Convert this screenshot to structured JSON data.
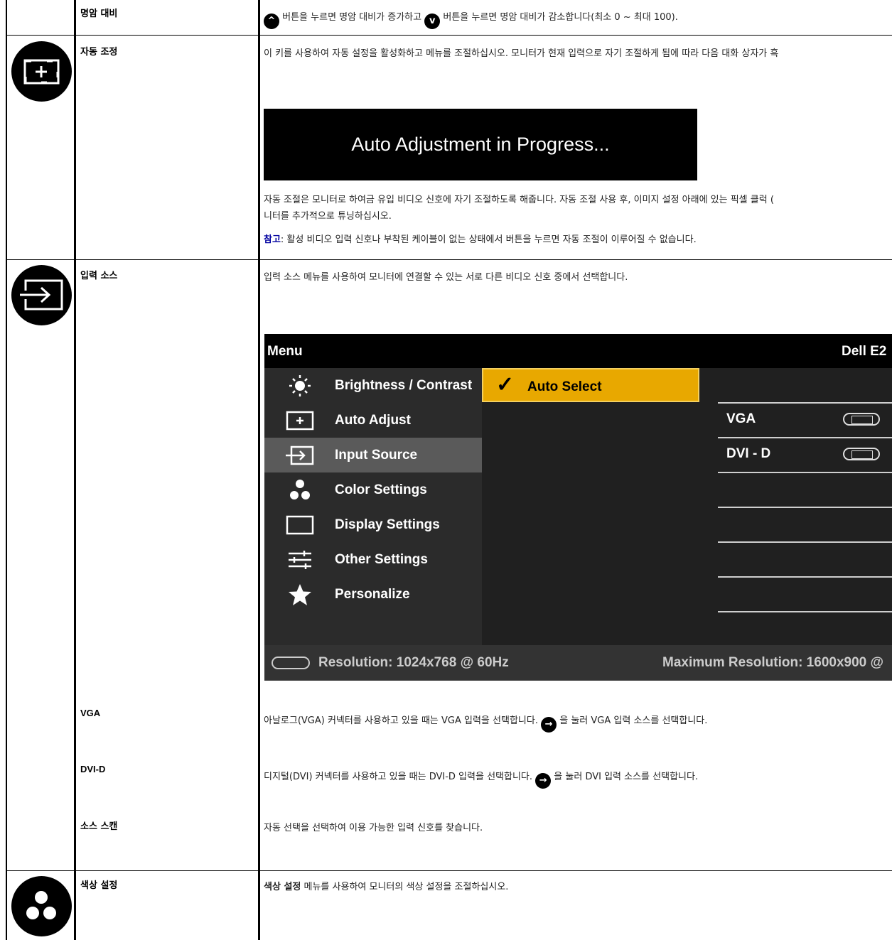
{
  "rows": {
    "contrast": {
      "label": "명암 대비",
      "desc_a": "버튼을 누르면 명암 대비가 증가하고",
      "desc_b": "버튼을 누르면 명암 대비가 감소합니다(최소 0 ~ 최대 100).",
      "up_glyph": "^",
      "down_glyph": "v"
    },
    "auto_adjust": {
      "label": "자동 조정",
      "desc": "이 키를 사용하여 자동 설정을 활성화하고 메뉴를 조절하십시오. 모니터가 현재 입력으로 자기 조절하게 됨에 따라 다음 대화 상자가 흑",
      "banner": "Auto Adjustment in Progress...",
      "desc2_line1": "자동 조절은 모니터로 하여금 유입 비디오 신호에 자기 조절하도록 해줍니다. 자동 조절 사용 후, 이미지 설정 아래에 있는 픽셀 클럭 (",
      "desc2_line2": "니터를 추가적으로 튜닝하십시오.",
      "note_title": "참고",
      "note_text": ": 활성 비디오 입력 신호나 부착된 케이블이 없는 상태에서 버튼을 누르면 자동 조절이 이루어질 수 없습니다."
    },
    "input_source": {
      "label": "입력 소스",
      "desc": "입력 소스 메뉴를 사용하여 모니터에 연결할 수 있는 서로 다른 비디오 신호 중에서 선택합니다."
    },
    "vga": {
      "label": "VGA",
      "desc_a": "아날로그(VGA) 커넥터를 사용하고 있을 때는 VGA 입력을 선택합니다.",
      "desc_b": "을 눌러 VGA 입력 소스를 선택합니다.",
      "glyph": "→"
    },
    "dvi": {
      "label": "DVI-D",
      "desc_a": "디지털(DVI) 커넥터를 사용하고 있을 때는 DVI-D 입력을 선택합니다.",
      "desc_b": "을 눌러 DVI 입력 소스를 선택합니다.",
      "glyph": "→"
    },
    "scan": {
      "label": "소스 스캔",
      "desc": "자동 선택을 선택하여 이용 가능한 입력 신호를 찾습니다."
    },
    "color": {
      "label": "색상 설정",
      "desc_bold": "색상 설정",
      "desc": " 메뉴를 사용하여 모니터의 색상 설정을 조절하십시오."
    }
  },
  "osd": {
    "title": "Menu",
    "model": "Dell E2",
    "menu_items": [
      {
        "label": "Brightness / Contrast",
        "icon": "sun-icon"
      },
      {
        "label": "Auto Adjust",
        "icon": "auto-adjust-icon"
      },
      {
        "label": "Input Source",
        "icon": "input-source-icon"
      },
      {
        "label": "Color Settings",
        "icon": "color-dots-icon"
      },
      {
        "label": "Display Settings",
        "icon": "display-rect-icon"
      },
      {
        "label": "Other Settings",
        "icon": "sliders-icon"
      },
      {
        "label": "Personalize",
        "icon": "star-icon"
      }
    ],
    "active_index": 2,
    "options": {
      "selected": "Auto Select",
      "check": "✓",
      "vga": "VGA",
      "dvi": "DVI - D"
    },
    "resolution": "Resolution: 1024x768 @ 60Hz",
    "max_resolution": "Maximum Resolution: 1600x900 @"
  }
}
